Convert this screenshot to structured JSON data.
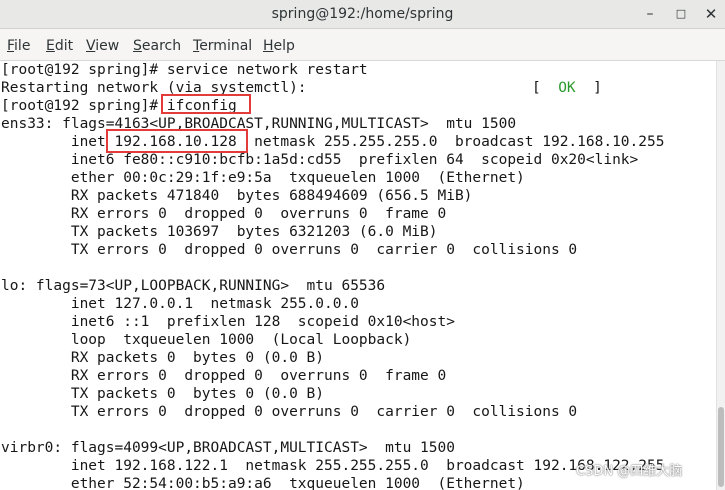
{
  "window": {
    "title": "spring@192:/home/spring",
    "min_glyph": "–",
    "max_glyph": "□",
    "close_glyph": "✕"
  },
  "menubar": [
    {
      "mnemonic": "F",
      "rest": "ile"
    },
    {
      "mnemonic": "E",
      "rest": "dit"
    },
    {
      "mnemonic": "V",
      "rest": "iew"
    },
    {
      "mnemonic": "S",
      "rest": "earch"
    },
    {
      "mnemonic": "T",
      "rest": "erminal"
    },
    {
      "mnemonic": "H",
      "rest": "elp"
    }
  ],
  "terminal": {
    "lines": [
      "[root@192 spring]# service network restart",
      "Restarting network (via systemctl):",
      "[root@192 spring]# ifconfig",
      "ens33: flags=4163<UP,BROADCAST,RUNNING,MULTICAST>  mtu 1500",
      "        inet 192.168.10.128  netmask 255.255.255.0  broadcast 192.168.10.255",
      "        inet6 fe80::c910:bcfb:1a5d:cd55  prefixlen 64  scopeid 0x20<link>",
      "        ether 00:0c:29:1f:e9:5a  txqueuelen 1000  (Ethernet)",
      "        RX packets 471840  bytes 688494609 (656.5 MiB)",
      "        RX errors 0  dropped 0  overruns 0  frame 0",
      "        TX packets 103697  bytes 6321203 (6.0 MiB)",
      "        TX errors 0  dropped 0 overruns 0  carrier 0  collisions 0",
      "",
      "lo: flags=73<UP,LOOPBACK,RUNNING>  mtu 65536",
      "        inet 127.0.0.1  netmask 255.0.0.0",
      "        inet6 ::1  prefixlen 128  scopeid 0x10<host>",
      "        loop  txqueuelen 1000  (Local Loopback)",
      "        RX packets 0  bytes 0 (0.0 B)",
      "        RX errors 0  dropped 0  overruns 0  frame 0",
      "        TX packets 0  bytes 0 (0.0 B)",
      "        TX errors 0  dropped 0 overruns 0  carrier 0  collisions 0",
      "",
      "virbr0: flags=4099<UP,BROADCAST,MULTICAST>  mtu 1500",
      "        inet 192.168.122.1  netmask 255.255.255.0  broadcast 192.168.122.255",
      "        ether 52:54:00:b5:a9:a6  txqueuelen 1000  (Ethernet)"
    ],
    "status": {
      "open": "[  ",
      "ok": "OK",
      "close": "  ]"
    }
  },
  "watermark": "CSDN @四维大脑"
}
